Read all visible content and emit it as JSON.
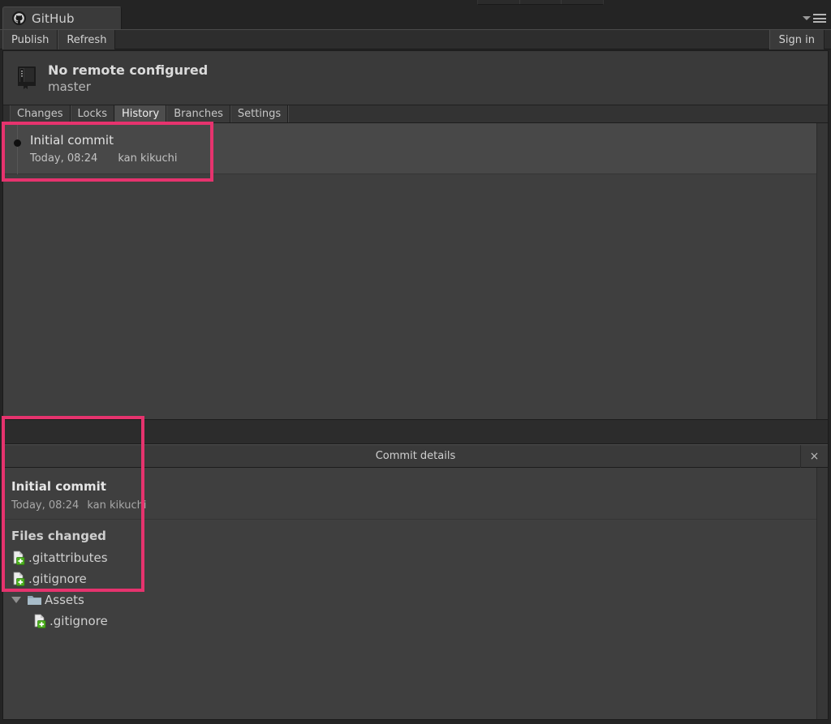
{
  "window": {
    "app_tab_label": "GitHub",
    "app_icon": "github-mark-icon",
    "caret_icon": "chevron-down-icon",
    "menu_icon": "hamburger-menu-icon"
  },
  "actionbar": {
    "publish_label": "Publish",
    "refresh_label": "Refresh",
    "signin_label": "Sign in"
  },
  "repo": {
    "icon": "repository-book-icon",
    "title": "No remote configured",
    "branch": "master"
  },
  "tabs": [
    {
      "label": "Changes",
      "active": false
    },
    {
      "label": "Locks",
      "active": false
    },
    {
      "label": "History",
      "active": true
    },
    {
      "label": "Branches",
      "active": false
    },
    {
      "label": "Settings",
      "active": false
    }
  ],
  "history": {
    "commits": [
      {
        "summary": "Initial commit",
        "date": "Today, 08:24",
        "author": "kan kikuchi",
        "selected": true
      }
    ]
  },
  "details": {
    "panel_title": "Commit details",
    "close_label": "×",
    "summary": "Initial commit",
    "date": "Today, 08:24",
    "author": "kan kikuchi",
    "files_changed_label": "Files changed",
    "files": [
      {
        "name": ".gitattributes",
        "type": "file",
        "status": "added",
        "depth": 0
      },
      {
        "name": ".gitignore",
        "type": "file",
        "status": "added",
        "depth": 0
      },
      {
        "name": "Assets",
        "type": "folder",
        "expanded": true,
        "depth": 0
      },
      {
        "name": ".gitignore",
        "type": "file",
        "status": "added",
        "depth": 1
      }
    ]
  },
  "colors": {
    "annotation": "#e6336e",
    "added_badge": "#4caf1e",
    "window_bg": "#3f3f3f",
    "chrome_bg": "#3a3a3a",
    "selected_row": "#484848"
  }
}
